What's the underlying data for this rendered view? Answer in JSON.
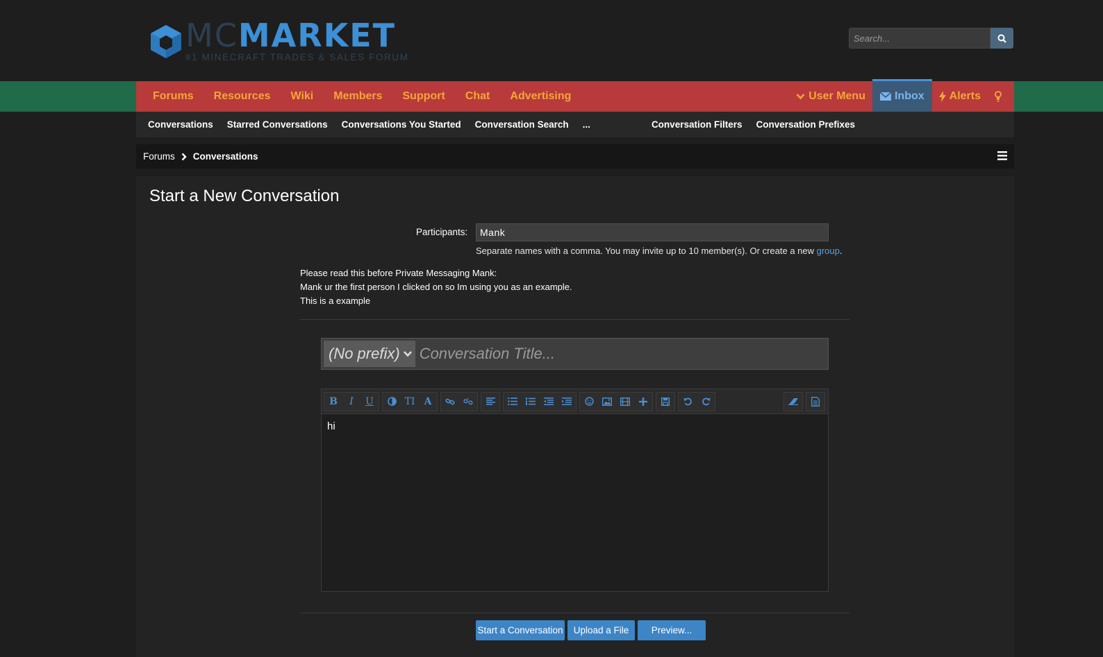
{
  "logo": {
    "part1": "MC",
    "part2": "MARKET",
    "tagline": "#1 MINECRAFT TRADES & SALES FORUM"
  },
  "search": {
    "placeholder": "Search..."
  },
  "nav": {
    "items": [
      "Forums",
      "Resources",
      "Wiki",
      "Members",
      "Support",
      "Chat",
      "Advertising"
    ],
    "user_menu": "User Menu",
    "inbox": "Inbox",
    "alerts": "Alerts"
  },
  "subnav": {
    "items": [
      "Conversations",
      "Starred Conversations",
      "Conversations You Started",
      "Conversation Search",
      "..."
    ],
    "right_items": [
      "Conversation Filters",
      "Conversation Prefixes"
    ]
  },
  "breadcrumb": {
    "root": "Forums",
    "current": "Conversations"
  },
  "form": {
    "page_title": "Start a New Conversation",
    "participants_label": "Participants:",
    "participants_value": "Mank",
    "hint_text": "Separate names with a comma. You may invite up to 10 member(s). Or create a new ",
    "hint_link": "group",
    "hint_end": ".",
    "note_lines": [
      "Please read this before Private Messaging Mank:",
      "Mank ur the first person I clicked on so Im using you as an example.",
      "This is a example"
    ],
    "prefix": "(No prefix)",
    "title_placeholder": "Conversation Title...",
    "body": "hi"
  },
  "buttons": {
    "start": "Start a Conversation",
    "upload": "Upload a File",
    "preview": "Preview..."
  },
  "colors": {
    "accent": "#3d85c6",
    "nav_red": "#b83a3a",
    "nav_text": "#f2a73a",
    "band_green": "#1f6b4a"
  }
}
